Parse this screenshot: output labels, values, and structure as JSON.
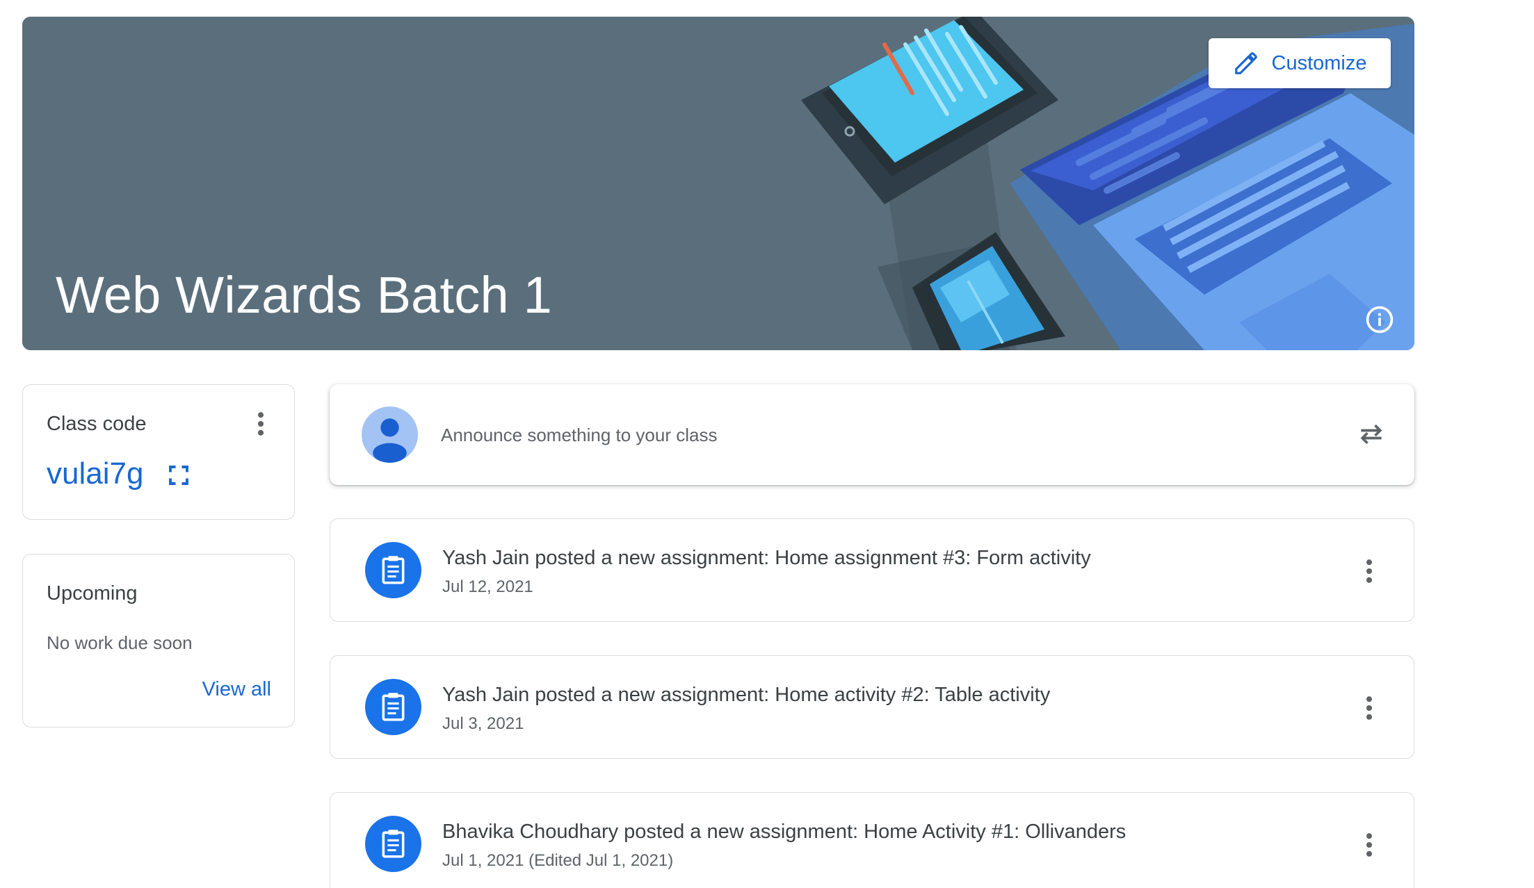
{
  "banner": {
    "title": "Web Wizards Batch 1",
    "customize_label": "Customize",
    "background_color": "#5a6f7b"
  },
  "class_code": {
    "title": "Class code",
    "code": "vulai7g"
  },
  "upcoming": {
    "title": "Upcoming",
    "message": "No work due soon",
    "view_all_label": "View all"
  },
  "announce": {
    "placeholder": "Announce something to your class"
  },
  "posts": [
    {
      "title": "Yash Jain posted a new assignment: Home assignment #3: Form activity",
      "date": "Jul 12, 2021"
    },
    {
      "title": "Yash Jain posted a new assignment: Home activity #2: Table activity",
      "date": "Jul 3, 2021"
    },
    {
      "title": "Bhavika Choudhary posted a new assignment: Home Activity #1: Ollivanders",
      "date": "Jul 1, 2021 (Edited Jul 1, 2021)"
    }
  ],
  "icons": {
    "customize": "pencil-icon",
    "info": "info-icon",
    "more": "more-vert-icon",
    "expand": "fullscreen-icon",
    "avatar": "user-avatar-icon",
    "repost": "repost-icon",
    "assignment": "assignment-icon"
  },
  "colors": {
    "accent": "#1967d2",
    "assignment_circle": "#1a73e8"
  }
}
